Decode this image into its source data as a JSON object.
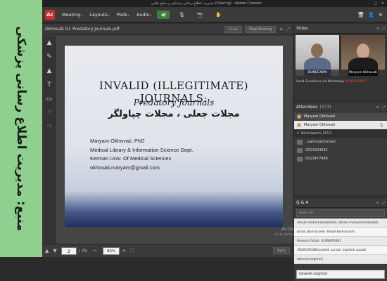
{
  "caption": {
    "text": "منبع: مدیریت اطلاع رسانی پزشکی"
  },
  "window": {
    "title": "مدیریت اطلاع رسانی پزشکی و منابع علمی (Sharing) - Adobe Connect",
    "minimize_glyph": "–",
    "maximize_glyph": "□",
    "close_glyph": "✕"
  },
  "menubar": {
    "logo": "Ac",
    "items": [
      "Meeting",
      "Layouts",
      "Pods",
      "Audio"
    ],
    "dropdown_glyph": "▾",
    "mic_glyph": "🎙",
    "cam_glyph": "📷",
    "raise_glyph": "✋",
    "right_glyphs": [
      "🖥",
      "👤",
      "≡"
    ]
  },
  "share_pod": {
    "title": "Okhovati Dr. Predatory Journals.pdf",
    "draw_label": "Draw",
    "stop_label": "Stop Sharing",
    "page_current": "2",
    "page_total": "/ 79",
    "zoom": "85%",
    "sync_label": "Sync",
    "tools": [
      "▲",
      "✎",
      "▲",
      "T",
      "▭",
      "↶",
      "↷"
    ]
  },
  "slide": {
    "title": "INVALID (ILLEGITIMATE) JOURNALS:",
    "subtitle": "Predatory Journals",
    "arabic": "مجلات جعلی ، مجلات چپاولگر",
    "author_lines": [
      "Maryam Okhovati, PhD",
      "Medical Library & Information Science Dept.",
      "Kerman Univ. Of Medical Sciences",
      "okhovati.maryam@gmail.com"
    ]
  },
  "video_pod": {
    "title": "Video",
    "participant_1": "DUNES.WIN",
    "participant_2": "Maryam Okhovati",
    "questions_line": "Send Questions via WhatsApp",
    "phone": "09166049907"
  },
  "attendees_pod": {
    "title": "Attendees",
    "count": "(373)",
    "host_name": "Maryam Okhovati",
    "presenter_name": "Maryam Okhovati",
    "participants_label": "Participants (372)",
    "rows": [
      "..bahmyarinzivan",
      "0013394031",
      "0013477486"
    ]
  },
  "qa_pod": {
    "title": "Q & A",
    "filter": "Open (3)",
    "rows": [
      "elham mohammadzadeh:  elham.mohammadzadeh.",
      "Khalil_Borhanzehi:  Khalil Borhanzehi",
      "Hossein fallah:  4189876461",
      "3920139186sepideh aarabi:  sepideh aarabi",
      "tahereh.toghroli:"
    ],
    "input_placeholder": "tahereh.toghroli"
  },
  "watermark": {
    "line1": "Activate Windows",
    "line2": "Go to Settings to activate Windows."
  }
}
